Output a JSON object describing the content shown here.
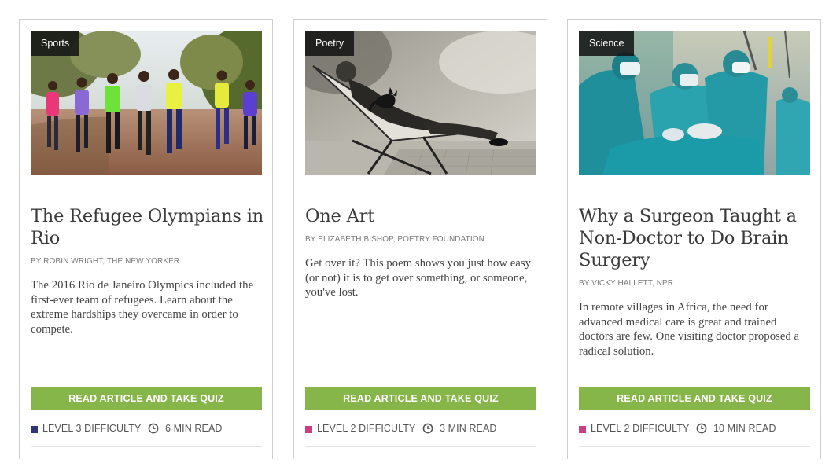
{
  "cards": [
    {
      "category": "Sports",
      "title": "The Refugee Olympians in Rio",
      "byline": "BY ROBIN WRIGHT, THE NEW YORKER",
      "summary": "The 2016 Rio de Janeiro Olympics included the first-ever team of refugees. Learn about the extreme hardships they overcame in order to compete.",
      "cta": "READ ARTICLE AND TAKE QUIZ",
      "difficulty": "LEVEL 3 DIFFICULTY",
      "difficulty_color": "#2e3579",
      "read_time": "6 MIN READ",
      "image": "runners-photo"
    },
    {
      "category": "Poetry",
      "title": "One Art",
      "byline": "BY ELIZABETH BISHOP, POETRY FOUNDATION",
      "summary": "Get over it? This poem shows you just how easy (or not) it is to get over something, or someone, you've lost.",
      "cta": "READ ARTICLE AND TAKE QUIZ",
      "difficulty": "LEVEL 2 DIFFICULTY",
      "difficulty_color": "#c9407f",
      "read_time": "3 MIN READ",
      "image": "poet-with-cat-photo"
    },
    {
      "category": "Science",
      "title": "Why a Surgeon Taught a Non-Doctor to Do Brain Surgery",
      "byline": "BY VICKY HALLETT, NPR",
      "summary": "In remote villages in Africa, the need for advanced medical care is great and trained doctors are few. One visiting doctor proposed a radical solution.",
      "cta": "READ ARTICLE AND TAKE QUIZ",
      "difficulty": "LEVEL 2 DIFFICULTY",
      "difficulty_color": "#c9407f",
      "read_time": "10 MIN READ",
      "image": "surgeons-photo"
    }
  ],
  "colors": {
    "cta_green": "#86b549",
    "category_tag_bg": "#141414"
  }
}
